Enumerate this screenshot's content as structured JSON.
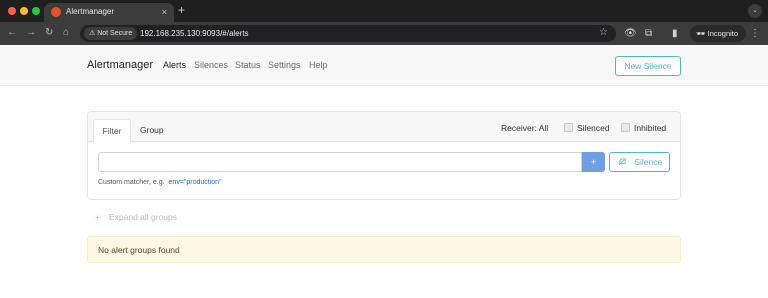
{
  "browser": {
    "tab_title": "Alertmanager",
    "tab_close": "×",
    "new_tab": "+",
    "tab_menu": "⌄",
    "security_label": "⚠ Not Secure",
    "url": "192.168.235.130:9093/#/alerts",
    "incognito_label": "Incognito",
    "nav": {
      "back": "←",
      "forward": "→",
      "reload": "↻",
      "home": "⌂"
    },
    "icons": {
      "star": "☆",
      "eye_off": "👁",
      "extensions": "⧉",
      "sidepanel": "▮",
      "incognito": "🕶",
      "menu": "⋮"
    }
  },
  "navbar": {
    "brand": "Alertmanager",
    "links": [
      "Alerts",
      "Silences",
      "Status",
      "Settings",
      "Help"
    ],
    "active_link": "Alerts",
    "new_silence_label": "New Silence"
  },
  "filter": {
    "tabs": [
      "Filter",
      "Group"
    ],
    "receiver_label": "Receiver: All",
    "silenced_label": "Silenced",
    "inhibited_label": "Inhibited",
    "matcher_value": "",
    "add_button": "+",
    "silence_button": "Silence",
    "hint_label": "Custom matcher, e.g.",
    "hint_example": "env=\"production\""
  },
  "groups": {
    "expand_icon": "+",
    "expand_label": "Expand all groups",
    "empty_message": "No alert groups found"
  },
  "colors": {
    "accent": "#56b6c9",
    "primary_button": "#6f9fe0",
    "warning_bg": "#fcf8e3"
  }
}
